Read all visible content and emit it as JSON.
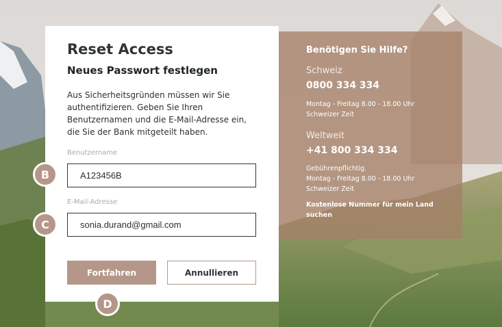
{
  "card": {
    "title": "Reset Access",
    "subtitle": "Neues Passwort festlegen",
    "description_lines": [
      "Aus Sicherheitsgründen müssen wir Sie",
      "authentifizieren. Geben Sie Ihren",
      "Benutzernamen und die E-Mail-Adresse ein,",
      "die Sie der Bank mitgeteilt haben."
    ],
    "username": {
      "label": "Benutzername",
      "value": "A123456B"
    },
    "email": {
      "label": "E-Mail-Adresse",
      "value": "sonia.durand@gmail.com"
    },
    "continue_label": "Fortfahren",
    "cancel_label": "Annullieren"
  },
  "help": {
    "title": "Benötigen Sie Hilfe?",
    "switzerland": {
      "region": "Schweiz",
      "phone": "0800 334 334",
      "hours_lines": [
        "Montag - Freitag 8.00 - 18.00 Uhr",
        "Schweizer Zeit"
      ]
    },
    "worldwide": {
      "region": "Weltweit",
      "phone": "+41 800 334 334",
      "info_lines": [
        "Gebührenpflichtig.",
        "Montag - Freitag 8.00 - 18.00 Uhr",
        "Schweizer Zeit"
      ]
    },
    "free_number_link_lines": [
      "Kostenlose Nummer für mein Land",
      "suchen"
    ]
  },
  "markers": {
    "b": "B",
    "c": "C",
    "d": "D"
  },
  "colors": {
    "accent": "#b5978a",
    "help_panel": "#a58068",
    "text_dark": "#2f3437"
  }
}
